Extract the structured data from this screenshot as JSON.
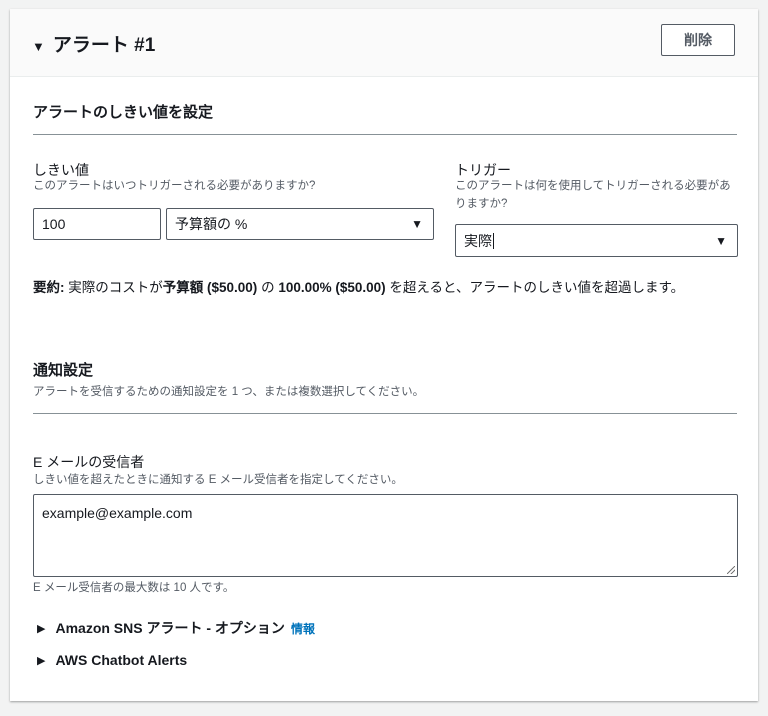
{
  "header": {
    "title": "アラート #1",
    "delete_label": "削除"
  },
  "threshold_section": {
    "heading": "アラートのしきい値を設定",
    "threshold": {
      "label": "しきい値",
      "description": "このアラートはいつトリガーされる必要がありますか?",
      "value": "100",
      "unit_selected": "予算額の %"
    },
    "trigger": {
      "label": "トリガー",
      "description": "このアラートは何を使用してトリガーされる必要がありますか?",
      "selected": "実際"
    },
    "summary": {
      "prefix": "要約:",
      "part1": " 実際のコストが",
      "budget": "予算額 ($50.00)",
      "part2": " の ",
      "percent": "100.00% ($50.00)",
      "part3": " を超えると、アラートのしきい値を超過します。"
    }
  },
  "notification_section": {
    "heading": "通知設定",
    "description": "アラートを受信するための通知設定を 1 つ、または複数選択してください。",
    "email": {
      "label": "E メールの受信者",
      "description": "しきい値を超えたときに通知する E メール受信者を指定してください。",
      "value": "example@example.com",
      "hint": "E メール受信者の最大数は 10 人です。"
    },
    "sns": {
      "label": "Amazon SNS アラート - オプション",
      "info": "情報"
    },
    "chatbot": {
      "label": "AWS Chatbot Alerts"
    }
  },
  "colors": {
    "link": "#0073bb",
    "border": "#545b64"
  }
}
